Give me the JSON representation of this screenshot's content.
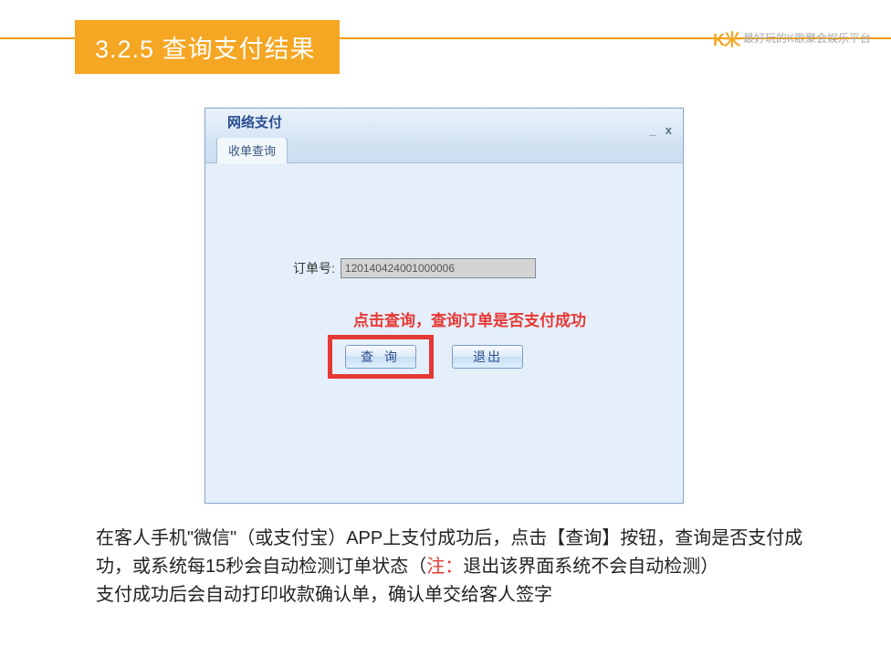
{
  "header": {
    "section_number": "3.2.5",
    "section_title": "查询支付结果",
    "brand_logo": "K米",
    "brand_tagline": "最好玩的K歌聚会娱乐平台"
  },
  "window": {
    "title": "网络支付",
    "tab_label": "收单查询",
    "order_label": "订单号:",
    "order_value": "120140424001000006",
    "hint": "点击查询，查询订单是否支付成功",
    "query_btn": "查 询",
    "exit_btn": "退出"
  },
  "description": {
    "line1_a": "在客人手机\"微信\"（或支付宝）APP上支付成功后，点击【查询】按钮，查询是否支付成功，或系统每15秒会自动检测订单状态（",
    "note_label": "注：",
    "line1_b": "退出该界面系统不会自动检测）",
    "line2": "支付成功后会自动打印收款确认单，确认单交给客人签字"
  }
}
